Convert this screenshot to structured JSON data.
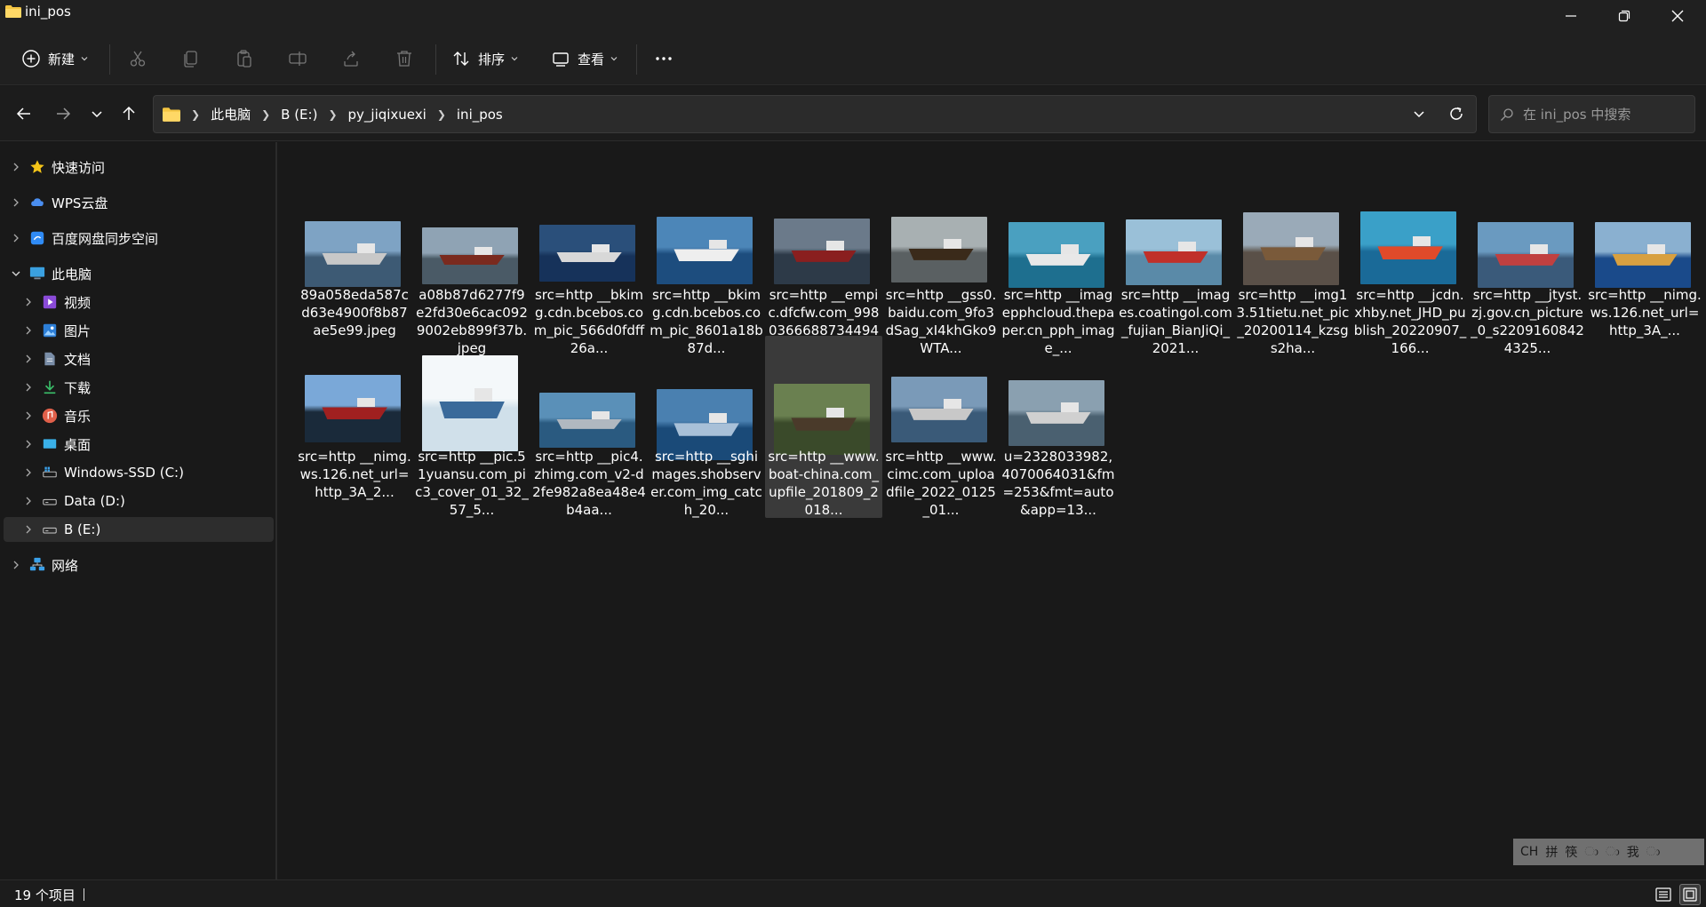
{
  "window": {
    "title": "ini_pos"
  },
  "toolbar": {
    "new_label": "新建",
    "sort_label": "排序",
    "view_label": "查看"
  },
  "address": {
    "crumbs": [
      "此电脑",
      "B (E:)",
      "py_jiqixuexi",
      "ini_pos"
    ]
  },
  "search": {
    "placeholder": "在 ini_pos 中搜索"
  },
  "sidebar": {
    "items": [
      {
        "label": "快速访问",
        "icon": "star-icon"
      },
      {
        "label": "WPS云盘",
        "icon": "cloud-icon"
      },
      {
        "label": "百度网盘同步空间",
        "icon": "baidu-sync-icon"
      },
      {
        "label": "此电脑",
        "icon": "computer-icon"
      },
      {
        "label": "视频",
        "icon": "video-icon"
      },
      {
        "label": "图片",
        "icon": "picture-icon"
      },
      {
        "label": "文档",
        "icon": "document-icon"
      },
      {
        "label": "下载",
        "icon": "download-icon"
      },
      {
        "label": "音乐",
        "icon": "music-icon"
      },
      {
        "label": "桌面",
        "icon": "desktop-icon"
      },
      {
        "label": "Windows-SSD (C:)",
        "icon": "windows-drive-icon"
      },
      {
        "label": "Data (D:)",
        "icon": "drive-icon"
      },
      {
        "label": "B (E:)",
        "icon": "drive-icon"
      },
      {
        "label": "网络",
        "icon": "network-icon"
      }
    ]
  },
  "files": [
    {
      "name": "89a058eda587cd63e4900f8b87ae5e99.jpeg",
      "colors": [
        "#7ea3c4",
        "#3d5a74",
        "#c8c8c8"
      ]
    },
    {
      "name": "a08b87d6277f9e2fd30e6cac0929002eb899f37b.jpeg",
      "colors": [
        "#8fa3b4",
        "#4a5a66",
        "#7a2a1e"
      ]
    },
    {
      "name": "src=http __bkimg.cdn.bcebos.com_pic_566d0fdff26a...",
      "colors": [
        "#2a4f7a",
        "#16325a",
        "#d8d8d8"
      ]
    },
    {
      "name": "src=http __bkimg.cdn.bcebos.com_pic_8601a18b87d...",
      "colors": [
        "#4c86b8",
        "#1d4d7e",
        "#eeeeee"
      ]
    },
    {
      "name": "src=http __empic.dfcfw.com_998036668873449474_w...",
      "colors": [
        "#6b7a8a",
        "#2d3a48",
        "#8a1f1f"
      ]
    },
    {
      "name": "src=http __gss0.baidu.com_9fo3dSag_xI4khGko9WTA...",
      "colors": [
        "#a8b0b2",
        "#5a6062",
        "#3a2a1a"
      ]
    },
    {
      "name": "src=http __imagepphcloud.thepaper.cn_pph_image_...",
      "colors": [
        "#4aa0c0",
        "#1e6f8f",
        "#e8e8e8"
      ]
    },
    {
      "name": "src=http __images.coatingol.com_fujian_BianJiQi_2021...",
      "colors": [
        "#9ac0d8",
        "#5a8aa8",
        "#c0302a"
      ]
    },
    {
      "name": "src=http __img13.51tietu.net_pic_20200114_kzsgs2ha...",
      "colors": [
        "#9aaab8",
        "#5a5048",
        "#7a5a3a"
      ]
    },
    {
      "name": "src=http __jcdn.xhby.net_JHD_publish_20220907_166...",
      "colors": [
        "#3aa0c8",
        "#1a6a98",
        "#e04a2a"
      ]
    },
    {
      "name": "src=http __jtyst.zj.gov.cn_picture_0_s22091608424325...",
      "colors": [
        "#6a9ac0",
        "#3a5a7a",
        "#c04040"
      ]
    },
    {
      "name": "src=http __nimg.ws.126.net_url=http_3A_...",
      "colors": [
        "#8ab0d0",
        "#1a4a8a",
        "#d8a040"
      ]
    },
    {
      "name": "src=http __nimg.ws.126.net_url=http_3A_2...",
      "colors": [
        "#7aa8d8",
        "#1a2a3a",
        "#a02020"
      ]
    },
    {
      "name": "src=http __pic.51yuansu.com_pic3_cover_01_32_57_5...",
      "colors": [
        "#f4f8fa",
        "#d0e0ea",
        "#3a6a9a"
      ]
    },
    {
      "name": "src=http __pic4.zhimg.com_v2-d2fe982a8ea48e4b4aa...",
      "colors": [
        "#5a90b8",
        "#2a5a80",
        "#b0b8c0"
      ]
    },
    {
      "name": "src=http __sghimages.shobserver.com_img_catch_20...",
      "colors": [
        "#4a80b0",
        "#1a4a78",
        "#a8c0d8"
      ]
    },
    {
      "name": "src=http __www.boat-china.com_upfile_201809_2018...",
      "colors": [
        "#6a8050",
        "#3a4a2a",
        "#4a3a2a"
      ]
    },
    {
      "name": "src=http __www.cimc.com_uploadfile_2022_0125_01...",
      "colors": [
        "#7a9ab8",
        "#3a5a78",
        "#c8c8c8"
      ]
    },
    {
      "name": "u=2328033982,4070064031&fm=253&fmt=auto&app=13...",
      "colors": [
        "#8aa0b0",
        "#4a6070",
        "#d0d0d0"
      ]
    }
  ],
  "selected_file_index": 16,
  "ime": {
    "items": [
      "CH",
      "拼",
      "筷",
      "ා",
      "ා",
      "我",
      "ා"
    ]
  },
  "status": {
    "count": "19 个项目"
  }
}
